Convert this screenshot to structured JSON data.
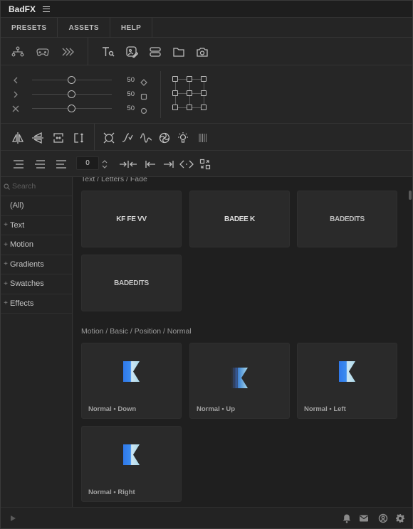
{
  "app": {
    "title": "BadFX",
    "menu_icon": "hamburger-icon"
  },
  "tabs": [
    {
      "label": "PRESETS"
    },
    {
      "label": "ASSETS"
    },
    {
      "label": "HELP"
    }
  ],
  "toolbar_top": {
    "icons": [
      "node-graph-icon",
      "gamepad-icon",
      "chevrons-icon",
      "text-search-icon",
      "image-edit-icon",
      "layers-stack-icon",
      "folder-icon",
      "camera-icon"
    ]
  },
  "transform": {
    "sliders": [
      {
        "axis": "left-chevron-icon",
        "value": "50",
        "end_icon": "diamond-icon"
      },
      {
        "axis": "right-chevron-icon",
        "value": "50",
        "end_icon": "square-icon"
      },
      {
        "axis": "x-icon",
        "value": "50",
        "end_icon": "circle-icon"
      }
    ],
    "anchor_grid": "anchor-grid"
  },
  "toolbar_effects": {
    "icons": [
      "flip-horizontal-icon",
      "flip-vertical-icon",
      "fit-width-icon",
      "fit-height-icon",
      "expand-icon",
      "curve-check-icon",
      "wave-icon",
      "spiral-icon",
      "bulb-icon",
      "barcode-icon"
    ]
  },
  "toolbar_align": {
    "icons": [
      "align-left-icon",
      "align-center-icon",
      "align-right-icon"
    ],
    "spacing_value": "0",
    "after_icons": [
      "collapse-horizontal-icon",
      "align-to-left-icon",
      "align-to-right-icon",
      "code-brackets-icon",
      "swap-icon"
    ]
  },
  "sidebar": {
    "search_placeholder": "Search",
    "all_label": "(All)",
    "categories": [
      {
        "label": "Text"
      },
      {
        "label": "Motion"
      },
      {
        "label": "Gradients"
      },
      {
        "label": "Swatches"
      },
      {
        "label": "Effects"
      }
    ]
  },
  "content": {
    "sections": [
      {
        "title": "Text / Letters / Fade",
        "cards": [
          {
            "preview": "KF FE VV"
          },
          {
            "preview": "BADEE K"
          },
          {
            "preview": "BADEDITS"
          },
          {
            "preview": "BADEDITS"
          }
        ]
      },
      {
        "title": "Motion / Basic / Position / Normal",
        "cards": [
          {
            "caption": "Normal • Down"
          },
          {
            "caption": "Normal • Up"
          },
          {
            "caption": "Normal • Left"
          },
          {
            "caption": "Normal • Right"
          }
        ]
      }
    ]
  },
  "statusbar": {
    "left_icon": "play-icon",
    "right_icons": [
      "bell-icon",
      "mail-icon",
      "account-icon",
      "settings-icon"
    ]
  },
  "colors": {
    "background": "#232323",
    "panel": "#262626",
    "card": "#2a2a2a",
    "logo_blue": "#3b8cf0",
    "logo_light": "#cfe6f2"
  }
}
